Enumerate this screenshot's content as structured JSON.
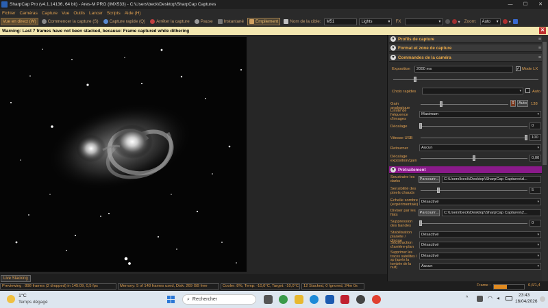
{
  "window": {
    "title": "SharpCap Pro (v4.1.14136, 64 bit) - Ares-M PRO (IMX533) - C:\\Users\\beck\\Desktop\\SharpCap Captures",
    "controls": [
      "—",
      "☐",
      "✕"
    ]
  },
  "menu": [
    "Fichier",
    "Caméras",
    "Capture",
    "Vue",
    "Outils",
    "Lancer",
    "Scripts",
    "Aide (H)"
  ],
  "toolbar": {
    "live_view": "Vue en direct (W)",
    "start_capture": "Commencer la capture (S)",
    "quick_capture": "Capture rapide (Q)",
    "stop_capture": "Arrêter la capture",
    "pause": "Pause",
    "snapshot": "Instantané",
    "stack": "Empilement",
    "target_label": "Nom de la cible:",
    "target_value": "M51",
    "frame_type": "Lights",
    "fx_label": "FX",
    "fx_value": "",
    "zoom_label": "Zoom:",
    "zoom_value": "Auto"
  },
  "warning": {
    "text": "Warning: Last 7 frames have not been stacked, because: Frame captured while dithering",
    "close": "✕"
  },
  "panel": {
    "sections": {
      "capture_profiles": "Profils de capture",
      "format_area": "Format et zone de capture",
      "camera_controls": "Commandes de la caméra",
      "preprocessing": "Prétraitement"
    },
    "exposure_label": "Exposition",
    "exposure_value": "2000 ms",
    "mode_lx_label": "Mode LX",
    "mode_lx_checked": true,
    "quick_choice_label": "Choix rapides",
    "auto_label": "Auto",
    "gain_label": "Gain analogique",
    "gain_auto": "Auto",
    "gain_value": "138",
    "frame_limit_label": "Limite de fréquence d'images",
    "frame_limit_value": "Maximum",
    "offset_label": "Décalage",
    "offset_value": "0",
    "usb_label": "Vitesse USB",
    "usb_value": "100",
    "flip_label": "Retourner",
    "flip_value": "Aucun",
    "exp_offset_label": "Décalage exposition/gain",
    "exp_offset_value": "0,00",
    "subtract_dark_label": "Soustraire les darks",
    "browse": "Parcourir...",
    "dark_path": "C:\\Users\\beck\\Desktop\\SharpCap Captures\\d...",
    "hot_pixel_label": "Sensibilité des pixels chauds",
    "hot_pixel_value": "5",
    "dark_scale_label": "Échelle sombre (expérimentale)",
    "dark_scale_value": "Désactivé",
    "flat_label": "Diviser par les flats",
    "flat_path": "C:\\Users\\beck\\Desktop\\SharpCap Captures\\2...",
    "banding_label": "Suppression des bandes",
    "banding_value": "0",
    "planet_stab_label": "Stabilisation planète / disque",
    "planet_stab_value": "Désactivé",
    "bg_sub_label": "Soustraction d'arrière-plan",
    "bg_sub_value": "Désactivé",
    "satellite_label": "Supprimer les traces satellites / sp (après la tombée de la nuit)",
    "satellite_value": "Désactivé",
    "last_value": "Aucun"
  },
  "live_stacking_button": "Live Stacking",
  "status": {
    "previewing": "Previewing : 898 frames (2 dropped) in 145:09, 0,5 fps",
    "memory": "Memory: 5 of 148 frames used, Disk: 269 GB free",
    "cooler": "Cooler: 8%, Temp: -10,0°C, Target: -10,0°C",
    "stacked": "12 Stacked, 0 Ignored, 24m 0s",
    "frame_label": "Frame :",
    "frame_value": "0,6/1,4",
    "frame_progress": 0.43
  },
  "taskbar": {
    "weather_temp": "1°C",
    "weather_desc": "Temps dégagé",
    "search_placeholder": "Rechercher",
    "time": "23:43",
    "date": "16/04/2026"
  },
  "colors": {
    "accent_orange": "#e0a050",
    "warning_bg": "#f3e7b0",
    "preprocessing_header": "#8a1a8a",
    "panel_bg": "#2b2b2b"
  }
}
